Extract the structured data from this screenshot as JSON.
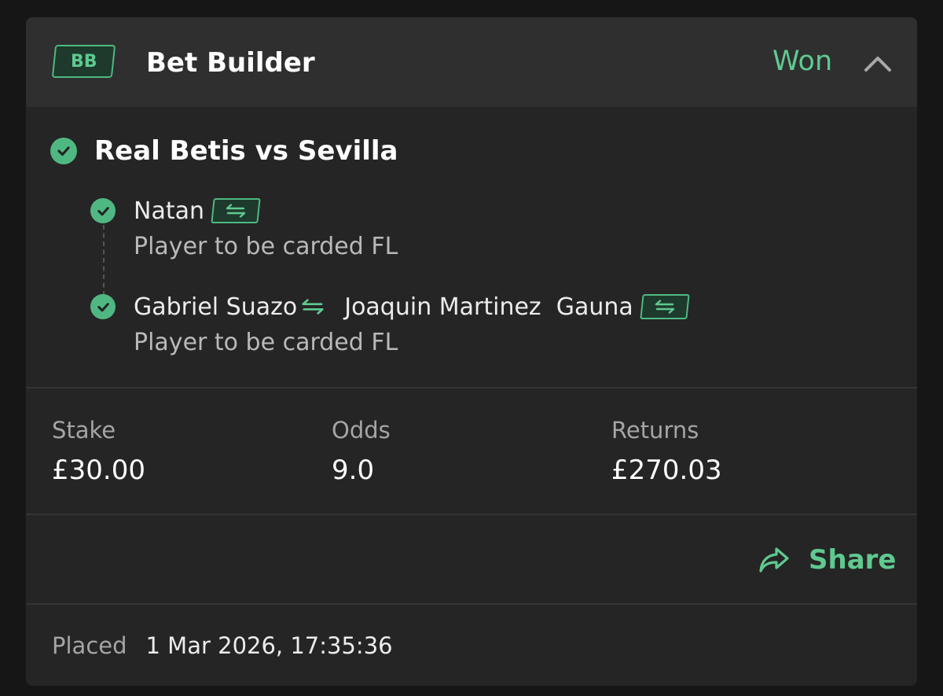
{
  "header": {
    "badge": "BB",
    "title": "Bet Builder",
    "status": "Won",
    "collapse_icon": "chevron-up-icon"
  },
  "match": {
    "title": "Real Betis vs Sevilla",
    "status_icon": "check-circle-icon"
  },
  "legs": [
    {
      "player": "Natan",
      "market": "Player to be carded FL",
      "swap_icon": "swap-arrows-icon"
    },
    {
      "player": "Gabriel Suazo",
      "replacement": "Joaquin Martinez  Gauna",
      "market": "Player to be carded FL",
      "swap_icon": "swap-arrows-icon"
    }
  ],
  "stats": {
    "stake_label": "Stake",
    "stake_value": "£30.00",
    "odds_label": "Odds",
    "odds_value": "9.0",
    "returns_label": "Returns",
    "returns_value": "£270.03"
  },
  "share": {
    "label": "Share",
    "icon": "share-arrow-icon"
  },
  "placed": {
    "label": "Placed",
    "value": "1 Mar 2026, 17:35:36"
  },
  "colors": {
    "accent": "#5fc990",
    "card_bg": "#252525",
    "header_bg": "#2f2f2f",
    "page_bg": "#161616"
  }
}
